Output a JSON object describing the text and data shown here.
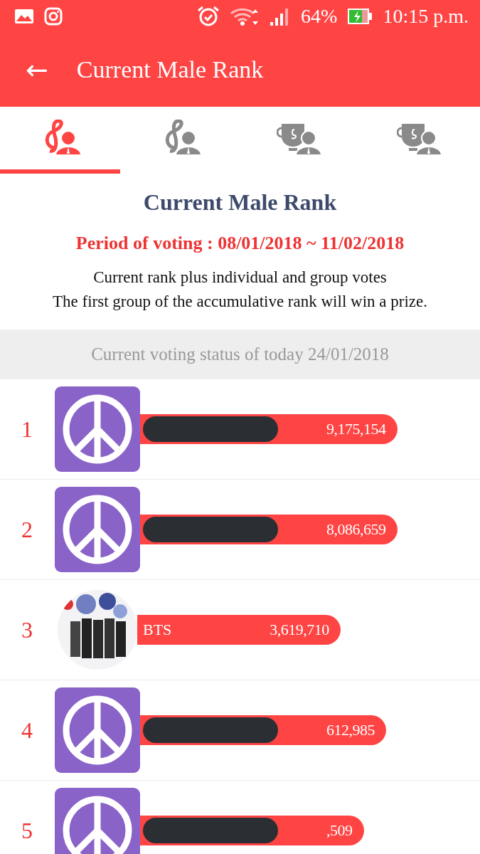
{
  "status_bar": {
    "battery": "64%",
    "time": "10:15 p.m."
  },
  "app_bar": {
    "back_icon": "←",
    "title": "Current Male Rank"
  },
  "tabs": [
    {
      "kind": "clef",
      "selected": true
    },
    {
      "kind": "clef",
      "selected": false
    },
    {
      "kind": "trophy",
      "selected": false
    },
    {
      "kind": "trophy",
      "selected": false
    }
  ],
  "intro": {
    "heading": "Current Male Rank",
    "period": "Period of voting : 08/01/2018 ~ 11/02/2018",
    "description": [
      "Current rank plus individual and group votes",
      "The first group of the accumulative rank will win a prize."
    ]
  },
  "status_banner": "Current voting status of today 24/01/2018",
  "ranking": [
    {
      "rank": "1",
      "kind": "sticker",
      "redacted": true,
      "votes": "9,175,154"
    },
    {
      "rank": "2",
      "kind": "sticker",
      "redacted": true,
      "votes": "8,086,659"
    },
    {
      "rank": "3",
      "kind": "picture",
      "redacted": false,
      "name": "BTS",
      "votes": "3,619,710"
    },
    {
      "rank": "4",
      "kind": "sticker",
      "redacted": true,
      "votes": "612,985"
    },
    {
      "rank": "5",
      "kind": "sticker",
      "redacted": true,
      "votes": ",509"
    }
  ]
}
